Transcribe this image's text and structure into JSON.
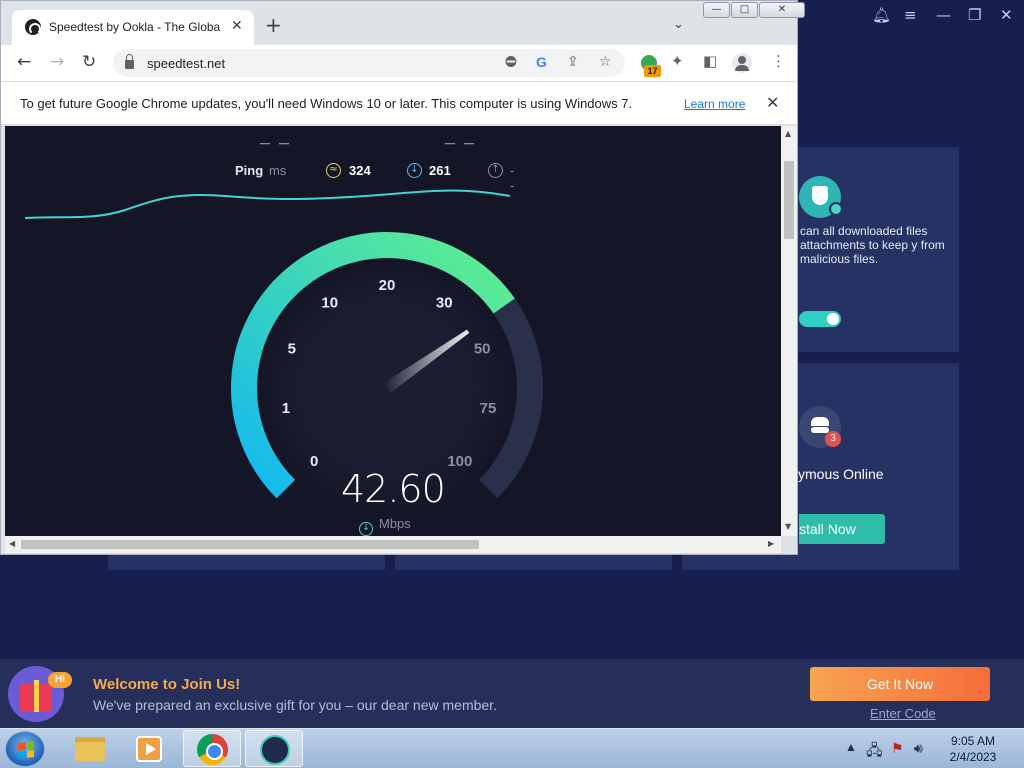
{
  "background_app": {
    "card1_desc": "can all downloaded files attachments to keep y from malicious files.",
    "card2_title": "ymous Online",
    "card2_badge": "3",
    "install_label": "stall Now"
  },
  "promo": {
    "badge": "Hi",
    "title": "Welcome to Join Us!",
    "subtitle": "We've prepared an exclusive gift for you – our dear new member.",
    "cta": "Get It Now",
    "link": "Enter Code"
  },
  "taskbar": {
    "time": "9:05 AM",
    "date": "2/4/2023"
  },
  "chrome": {
    "tab_title": "Speedtest by Ookla - The Global",
    "url": "speedtest.net",
    "extension_badge": "17",
    "infobar_text": "To get future Google Chrome updates, you'll need Windows 10 or later. This computer is using Windows 7.",
    "infobar_link": "Learn more"
  },
  "speedtest": {
    "top_dashes_left": "_ _",
    "top_dashes_right": "_ _",
    "ping_label": "Ping",
    "ping_unit": "ms",
    "ping_idle": "324",
    "ping_download": "261",
    "ping_upload": "--",
    "gauge_ticks": [
      "0",
      "1",
      "5",
      "10",
      "20",
      "30",
      "50",
      "75",
      "100"
    ],
    "gauge_value": 42.6,
    "speed_display": "42.60",
    "speed_unit": "Mbps"
  },
  "colors": {
    "gauge_start": "#12b8f0",
    "gauge_end": "#61f08c",
    "page_bg": "#141526",
    "accent_orange": "#f56d3b"
  }
}
